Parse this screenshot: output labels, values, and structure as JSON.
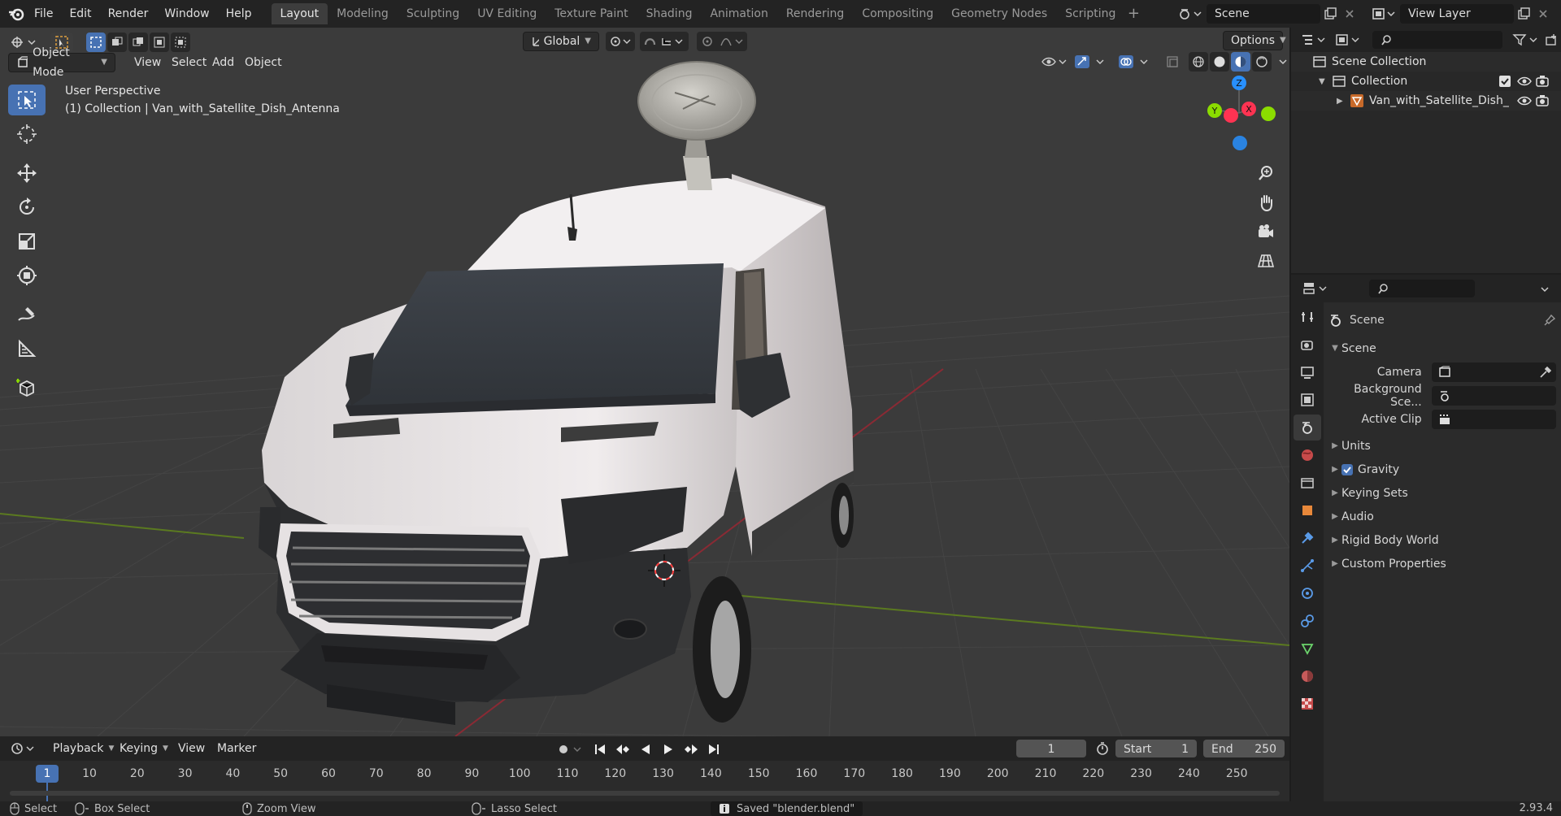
{
  "topbar": {
    "menus": [
      "File",
      "Edit",
      "Render",
      "Window",
      "Help"
    ],
    "workspaces": [
      "Layout",
      "Modeling",
      "Sculpting",
      "UV Editing",
      "Texture Paint",
      "Shading",
      "Animation",
      "Rendering",
      "Compositing",
      "Geometry Nodes",
      "Scripting"
    ],
    "active_workspace": "Layout",
    "scene_name": "Scene",
    "view_layer_name": "View Layer"
  },
  "viewport": {
    "mode": "Object Mode",
    "menus": [
      "View",
      "Select",
      "Add",
      "Object"
    ],
    "transform_orientation": "Global",
    "options_label": "Options",
    "perspective_label": "User Perspective",
    "collection_label": "(1) Collection | Van_with_Satellite_Dish_Antenna",
    "gizmo": {
      "z": "Z",
      "y": "Y",
      "x": "X"
    }
  },
  "outliner": {
    "root": "Scene Collection",
    "collection": "Collection",
    "object": "Van_with_Satellite_Dish_"
  },
  "properties": {
    "context": "Scene",
    "panel_title": "Scene",
    "fields": [
      {
        "label": "Camera",
        "value": ""
      },
      {
        "label": "Background Sce...",
        "value": ""
      },
      {
        "label": "Active Clip",
        "value": ""
      }
    ],
    "subpanels": [
      "Units",
      "Gravity",
      "Keying Sets",
      "Audio",
      "Rigid Body World",
      "Custom Properties"
    ],
    "gravity_checked": true
  },
  "timeline": {
    "menus": [
      "Playback",
      "Keying",
      "View",
      "Marker"
    ],
    "current_frame": "1",
    "start_label": "Start",
    "start_value": "1",
    "end_label": "End",
    "end_value": "250",
    "ticks": [
      "1",
      "10",
      "20",
      "30",
      "40",
      "50",
      "60",
      "70",
      "80",
      "90",
      "100",
      "110",
      "120",
      "130",
      "140",
      "150",
      "160",
      "170",
      "180",
      "190",
      "200",
      "210",
      "220",
      "230",
      "240",
      "250"
    ]
  },
  "statusbar": {
    "select": "Select",
    "box_select": "Box Select",
    "zoom_view": "Zoom View",
    "lasso_select": "Lasso Select",
    "message": "Saved \"blender.blend\"",
    "version": "2.93.4"
  },
  "colors": {
    "accent": "#4772b3",
    "x_axis": "#ff3352",
    "y_axis": "#8bdc00",
    "z_axis": "#2890ff"
  }
}
